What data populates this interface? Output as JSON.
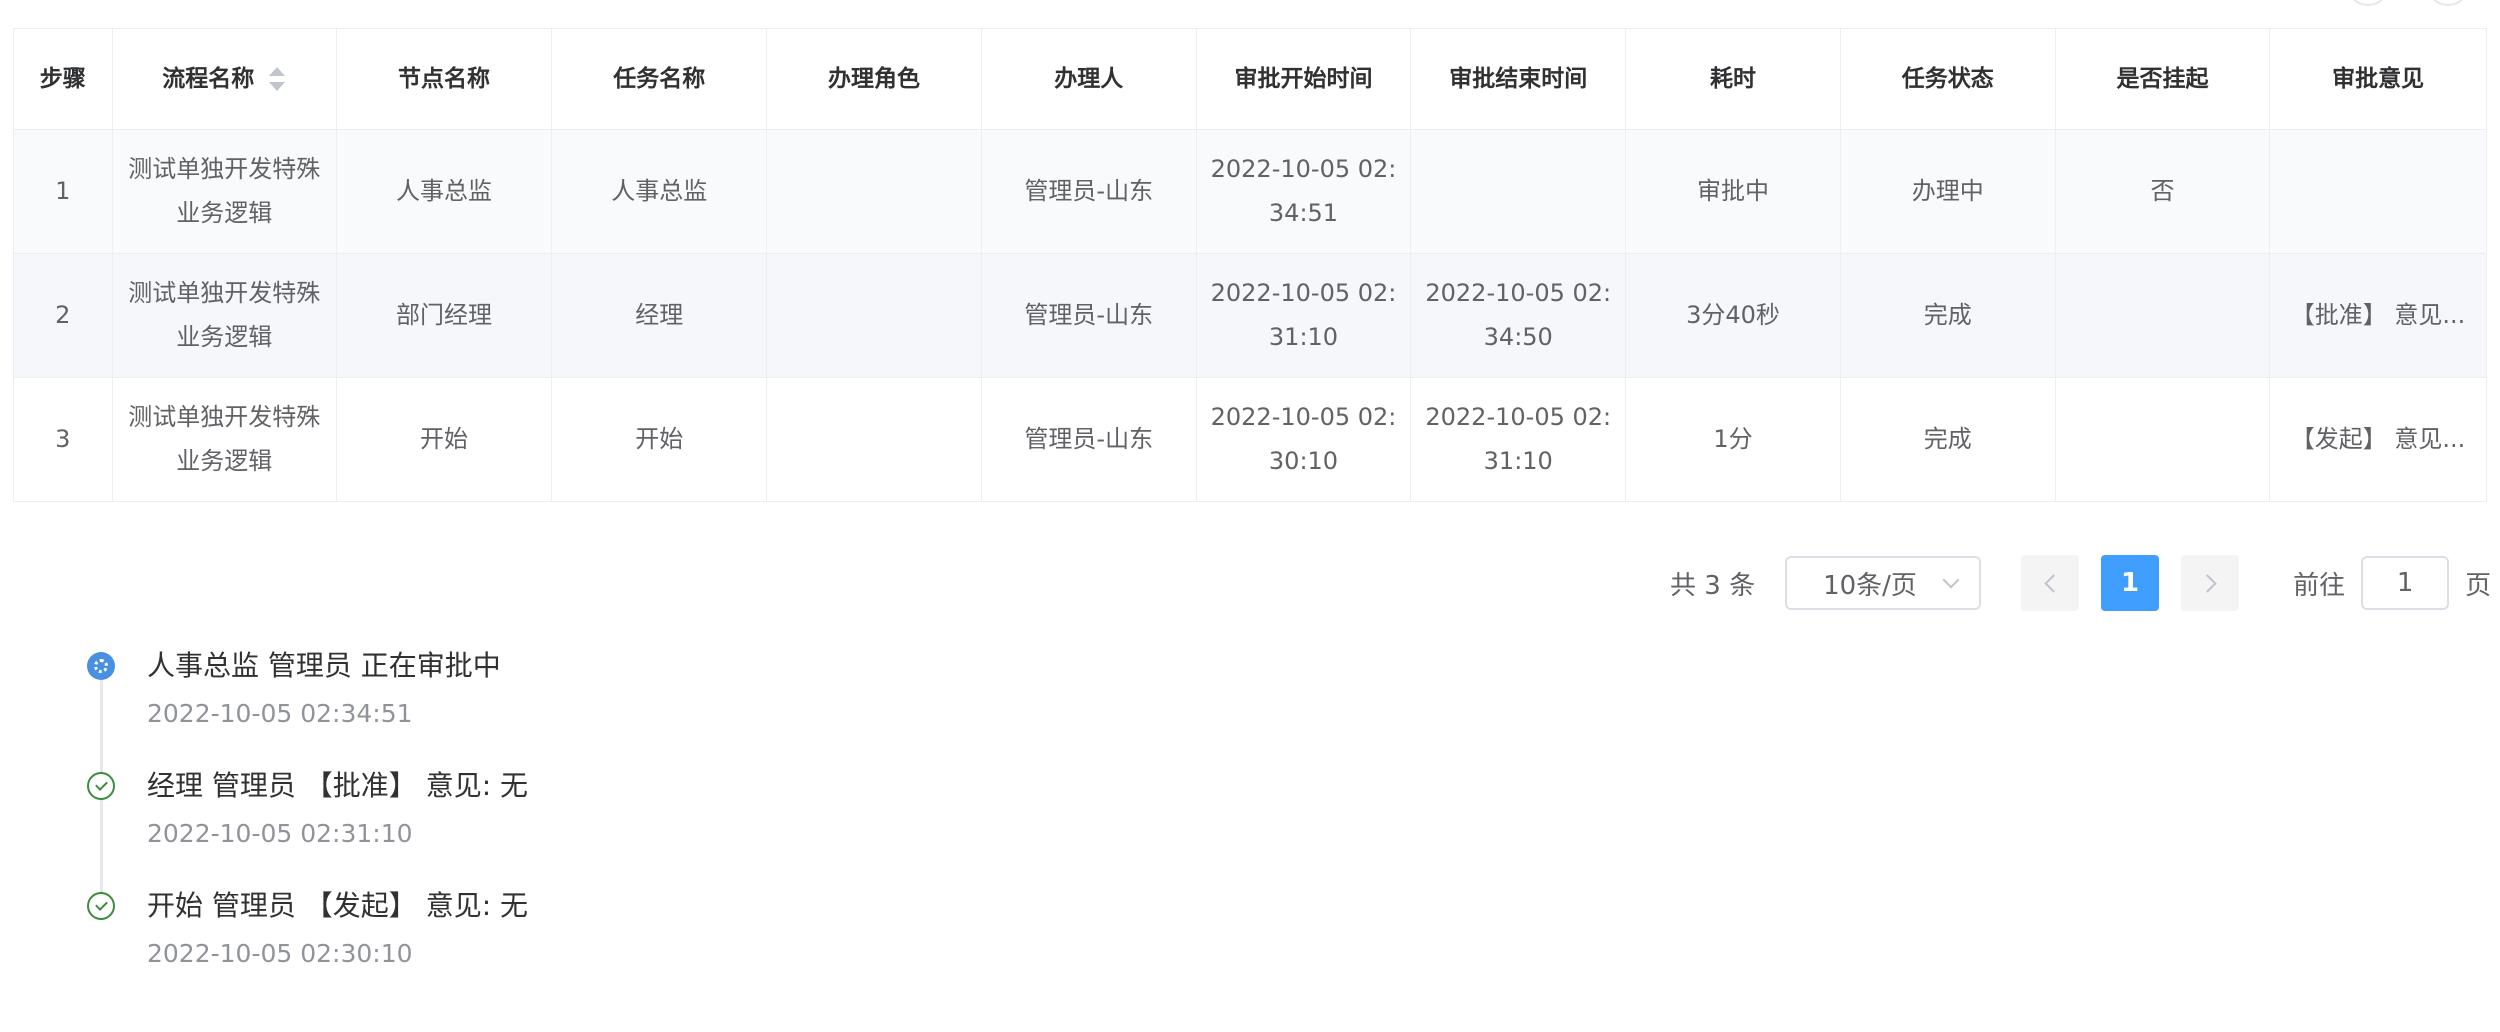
{
  "table": {
    "headers": {
      "step": "步骤",
      "process_name": "流程名称",
      "node_name": "节点名称",
      "task_name": "任务名称",
      "role": "办理角色",
      "handler": "办理人",
      "start_time": "审批开始时间",
      "end_time": "审批结束时间",
      "duration": "耗时",
      "task_status": "任务状态",
      "suspended": "是否挂起",
      "opinion": "审批意见"
    },
    "rows": [
      {
        "step": "1",
        "process_name": "测试单独开发特殊业务逻辑",
        "node_name": "人事总监",
        "task_name": "人事总监",
        "role": "",
        "handler": "管理员-山东",
        "start_time": "2022-10-05 02:34:51",
        "end_time": "",
        "duration": "审批中",
        "task_status": "办理中",
        "suspended": "否",
        "opinion": ""
      },
      {
        "step": "2",
        "process_name": "测试单独开发特殊业务逻辑",
        "node_name": "部门经理",
        "task_name": "经理",
        "role": "",
        "handler": "管理员-山东",
        "start_time": "2022-10-05 02:31:10",
        "end_time": "2022-10-05 02:34:50",
        "duration": "3分40秒",
        "task_status": "完成",
        "suspended": "",
        "opinion": "【批准】 意见..."
      },
      {
        "step": "3",
        "process_name": "测试单独开发特殊业务逻辑",
        "node_name": "开始",
        "task_name": "开始",
        "role": "",
        "handler": "管理员-山东",
        "start_time": "2022-10-05 02:30:10",
        "end_time": "2022-10-05 02:31:10",
        "duration": "1分",
        "task_status": "完成",
        "suspended": "",
        "opinion": "【发起】 意见..."
      }
    ]
  },
  "pagination": {
    "total": "共 3 条",
    "page_size": "10条/页",
    "current_page": "1",
    "goto_prefix": "前往",
    "goto_value": "1",
    "goto_suffix": "页"
  },
  "timeline": [
    {
      "icon": "loading-icon",
      "title": "人事总监 管理员 正在审批中",
      "time": "2022-10-05 02:34:51"
    },
    {
      "icon": "check-circle-icon",
      "title": "经理 管理员 【批准】 意见: 无",
      "time": "2022-10-05 02:31:10"
    },
    {
      "icon": "check-circle-icon",
      "title": "开始 管理员 【发起】 意见: 无",
      "time": "2022-10-05 02:30:10"
    }
  ],
  "colors": {
    "primary": "#409eff",
    "loading_node": "#4a90e2",
    "success": "#388e3c",
    "border": "#ebeef5"
  }
}
